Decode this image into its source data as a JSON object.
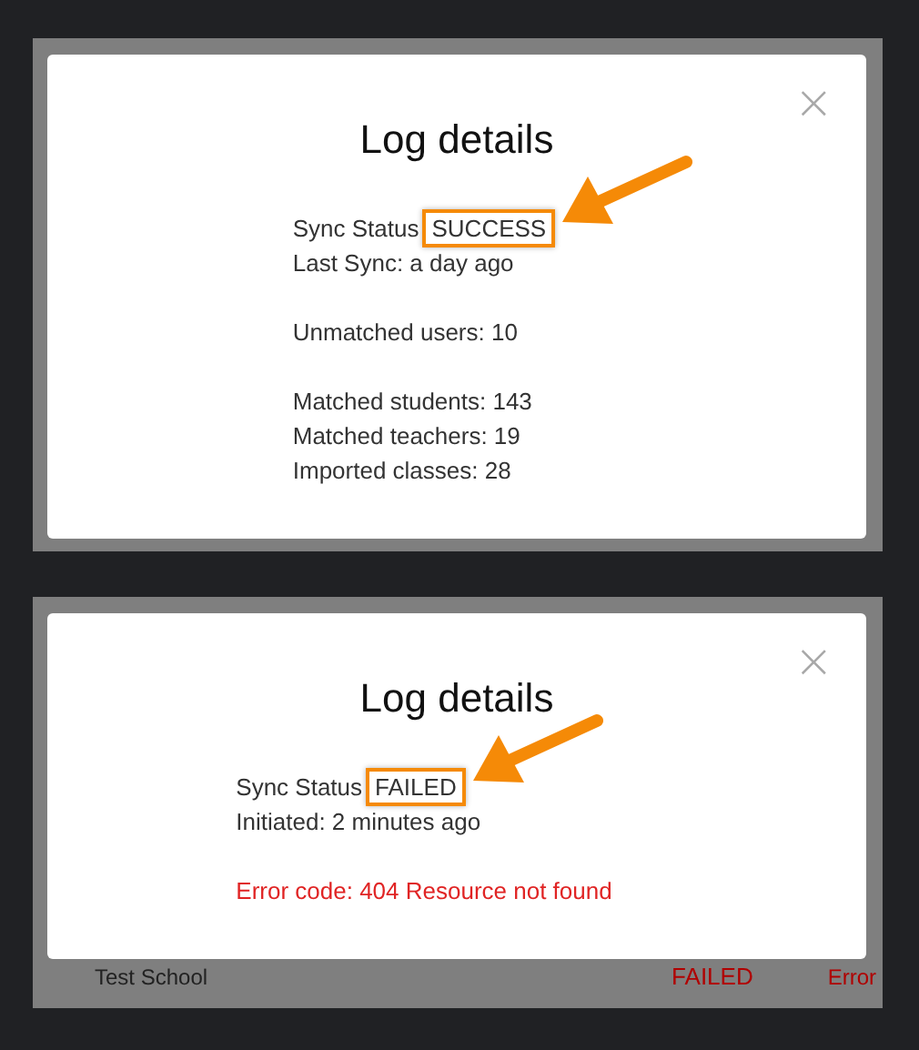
{
  "dialogs": [
    {
      "title": "Log details",
      "close": "×",
      "status_label": "Sync Status",
      "status": "SUCCESS",
      "status_highlighted": true,
      "groups": [
        {
          "lines": [
            {
              "text": "Last Sync: a day ago",
              "kind": "info"
            }
          ]
        },
        {
          "lines": [
            {
              "text": "Unmatched users: 10",
              "kind": "info"
            }
          ]
        },
        {
          "lines": [
            {
              "text": "Matched students: 143",
              "kind": "info"
            },
            {
              "text": "Matched teachers: 19",
              "kind": "info"
            },
            {
              "text": "Imported classes: 28",
              "kind": "info"
            }
          ]
        }
      ]
    },
    {
      "title": "Log details",
      "close": "×",
      "status_label": "Sync Status",
      "status": "FAILED",
      "status_highlighted": true,
      "groups": [
        {
          "lines": [
            {
              "text": "Initiated: 2 minutes ago",
              "kind": "info"
            }
          ]
        },
        {
          "lines": [
            {
              "text": "Error code: 404 Resource not found",
              "kind": "error"
            }
          ]
        }
      ],
      "background_row": [
        {
          "text": "Test School",
          "kind": "name"
        },
        {
          "text": "FAILED",
          "kind": "status"
        },
        {
          "text": "Error",
          "kind": "link"
        }
      ]
    }
  ]
}
